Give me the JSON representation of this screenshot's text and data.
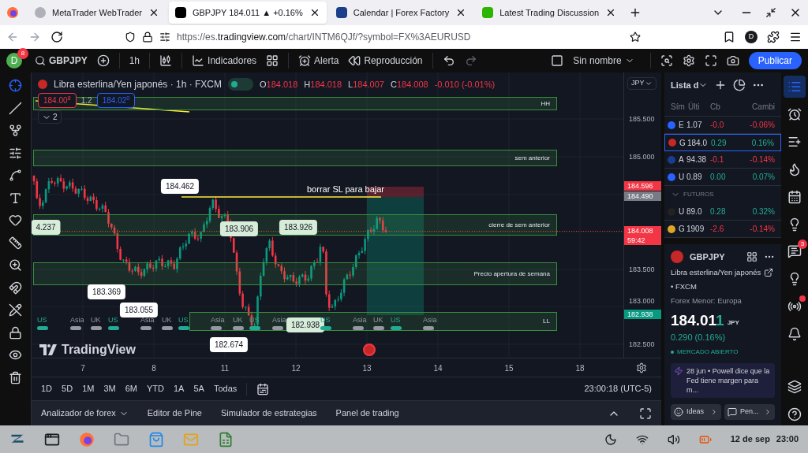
{
  "browser": {
    "tabs": [
      {
        "title": "MetaTrader WebTrader",
        "kind": "generic",
        "selected": false
      },
      {
        "title": "GBPJPY 184.011 ▲ +0.16%",
        "kind": "tradingview",
        "selected": true
      },
      {
        "title": "Calendar | Forex Factory",
        "kind": "calendar",
        "selected": false
      },
      {
        "title": "Latest Trading Discussion",
        "kind": "forum",
        "selected": false
      }
    ],
    "url_start": "https://es.",
    "url_domain": "tradingview.com",
    "url_rest": "/chart/INTM6QJf/?symbol=FX%3AEURUSD",
    "profile": "D"
  },
  "toolbar": {
    "avatar": "D",
    "notifications": "8",
    "symbol": "GBPJPY",
    "interval": "1h",
    "indicators": "Indicadores",
    "alert": "Alerta",
    "replay": "Reproducción",
    "layout_name": "Sin nombre",
    "publish": "Publicar"
  },
  "legend": {
    "title": "Libra esterlina/Yen japonés · 1h · FXCM",
    "ohlc": [
      {
        "label": "O",
        "value": "184.018"
      },
      {
        "label": "H",
        "value": "184.018"
      },
      {
        "label": "L",
        "value": "184.007"
      },
      {
        "label": "C",
        "value": "184.008"
      }
    ],
    "change": "-0.010 (-0.01%)",
    "sell": "184.00$^{8}$",
    "spread": "1.2",
    "buy": "184.02$^{0}$",
    "collapsed_count": "2",
    "currency": "JPY"
  },
  "chart": {
    "zones": [
      "HH",
      "sem anterior",
      "cierre de sem anterior",
      "Precio apertura de  semana",
      "LL"
    ],
    "annotation": "borrar SL para bajar",
    "price_labels": [
      {
        "text": "184.462",
        "highlighted": false
      },
      {
        "text": "4.237",
        "highlighted": true
      },
      {
        "text": "183.906",
        "highlighted": true
      },
      {
        "text": "183.926",
        "highlighted": true
      },
      {
        "text": "183.369",
        "highlighted": false
      },
      {
        "text": "183.055",
        "highlighted": false
      },
      {
        "text": "182.938",
        "highlighted": true
      },
      {
        "text": "182.674",
        "highlighted": false
      }
    ],
    "sessions": [
      {
        "label": "US",
        "color": "#22ab94"
      },
      {
        "label": "Asia",
        "color": "#9598a1"
      },
      {
        "label": "UK",
        "color": "#9598a1"
      },
      {
        "label": "US",
        "color": "#22ab94"
      },
      {
        "label": "Asia",
        "color": "#9598a1"
      },
      {
        "label": "UK",
        "color": "#9598a1"
      },
      {
        "label": "US",
        "color": "#22ab94"
      },
      {
        "label": "Asia",
        "color": "#9598a1"
      },
      {
        "label": "UK",
        "color": "#9598a1"
      },
      {
        "label": "US",
        "color": "#22ab94"
      },
      {
        "label": "Asia",
        "color": "#9598a1"
      },
      {
        "label": "US",
        "color": "#22ab94"
      },
      {
        "label": "Asia",
        "color": "#9598a1"
      },
      {
        "label": "UK",
        "color": "#9598a1"
      },
      {
        "label": "US",
        "color": "#22ab94"
      },
      {
        "label": "Asia",
        "color": "#9598a1"
      }
    ],
    "y_ticks": [
      "185.500",
      "185.000",
      "183.500",
      "183.000",
      "182.500"
    ],
    "axis_tags": [
      {
        "value": "184.596",
        "color": "#f23645"
      },
      {
        "value": "184.490",
        "color": "#787b86"
      },
      {
        "value": "184.008",
        "sub": "59:42",
        "color": "#f23645"
      },
      {
        "value": "182.938",
        "color": "#089981"
      }
    ],
    "x_ticks": [
      "7",
      "8",
      "11",
      "12",
      "13",
      "14",
      "15",
      "18"
    ],
    "logo": "TradingView"
  },
  "timeframes": [
    "1D",
    "5D",
    "1M",
    "3M",
    "6M",
    "YTD",
    "1A",
    "5A",
    "Todas"
  ],
  "clock": "23:00:18 (UTC-5)",
  "panel_tabs": [
    {
      "label": "Analizador de forex",
      "menu": true
    },
    {
      "label": "Editor de Pine",
      "menu": false
    },
    {
      "label": "Simulador de estrategias",
      "menu": false
    },
    {
      "label": "Panel de trading",
      "menu": false
    }
  ],
  "watchlist": {
    "title": "Lista d",
    "columns": [
      "Sím",
      "Últi",
      "Cb",
      "Cambi"
    ],
    "rows": [
      {
        "kind": "row",
        "symbol": "E",
        "last": "1.07",
        "change": "-0.0",
        "percent": "-0.06%",
        "positive": false,
        "selected": false,
        "color": "#2962ff"
      },
      {
        "kind": "row",
        "symbol": "G",
        "last": "184.0",
        "change": "0.29",
        "percent": "0.16%",
        "positive": true,
        "selected": true,
        "color": "#c62828"
      },
      {
        "kind": "row",
        "symbol": "A",
        "last": "94.38",
        "change": "-0.1",
        "percent": "-0.14%",
        "positive": false,
        "selected": false,
        "color": "#1a3d8f"
      },
      {
        "kind": "row",
        "symbol": "U",
        "last": "0.89",
        "change": "0.00",
        "percent": "0.07%",
        "positive": true,
        "selected": false,
        "color": "#2962ff"
      },
      {
        "kind": "section",
        "symbol": "FUTUROS"
      },
      {
        "kind": "row",
        "symbol": "U",
        "last": "89.0",
        "change": "0.28",
        "percent": "0.32%",
        "positive": true,
        "selected": false,
        "color": "#222222"
      },
      {
        "kind": "row",
        "symbol": "G",
        "last": "1909",
        "change": "-2.6",
        "percent": "-0.14%",
        "positive": false,
        "selected": false,
        "color": "#e0a526"
      }
    ]
  },
  "details": {
    "symbol": "GBPJPY",
    "name": "Libra esterlina/Yen japonés",
    "exchange": "• FXCM",
    "category": "Forex Menor: Europa",
    "price": "184.01",
    "price_last": "1",
    "currency": "JPY",
    "change": "0.290 (0.16%)",
    "status": "MERCADO ABIERTO",
    "news": "28 jun  • Powell dice que la Fed tiene margen para m...",
    "buttons": [
      "Ideas",
      "Pen..."
    ]
  },
  "right_bar": [
    {
      "kind": "list",
      "selected": true,
      "dot": false
    },
    {
      "kind": "alarm",
      "selected": false,
      "dot": false
    },
    {
      "kind": "add-list",
      "selected": false,
      "dot": false
    },
    {
      "kind": "hot",
      "selected": false,
      "dot": false
    },
    {
      "kind": "calendar",
      "selected": false,
      "dot": false
    },
    {
      "kind": "ideas",
      "selected": false,
      "dot": false
    },
    {
      "kind": "chat",
      "selected": false,
      "badge": "3",
      "dot": false
    },
    {
      "kind": "signals",
      "selected": false,
      "dot": false
    },
    {
      "kind": "stream",
      "selected": false,
      "dot": true
    },
    {
      "kind": "alerts",
      "selected": false,
      "dot": false
    },
    {
      "kind": "layers",
      "selected": false,
      "dot": false
    },
    {
      "kind": "help",
      "selected": false,
      "dot": false
    }
  ],
  "taskbar": {
    "date": "12 de sep",
    "time": "23:00"
  }
}
